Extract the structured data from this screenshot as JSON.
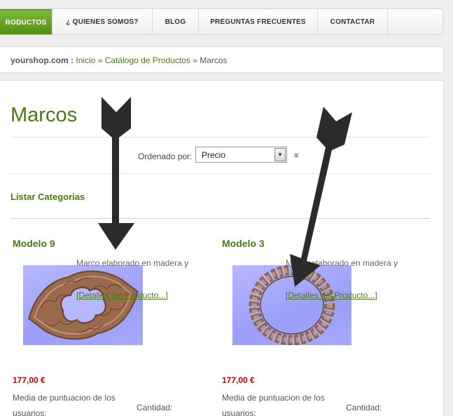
{
  "nav": {
    "items": [
      {
        "label": "RODUCTOS",
        "active": true
      },
      {
        "label": "¿ QUIENES SOMOS?"
      },
      {
        "label": "BLOG"
      },
      {
        "label": "PREGUNTAS FRECUENTES"
      },
      {
        "label": "CONTACTAR"
      }
    ]
  },
  "breadcrumb": {
    "host": "yourshop.com :",
    "home": "Inicio",
    "sep": "»",
    "catalog": "Catálogo de Productos",
    "current": "Marcos"
  },
  "page": {
    "title": "Marcos",
    "sort_label": "Ordenado por:",
    "sort_value": "Precio",
    "list_categories": "Listar Categorias"
  },
  "products": [
    {
      "name": "Modelo 9",
      "desc": "Marco elaborado en madera y",
      "link": "[Detalles del Producto...]",
      "price": "177,00 €",
      "rating": "Media de puntuacion de los usuarios:",
      "qty": "Cantidad:"
    },
    {
      "name": "Modelo 3",
      "desc": "Marco elaborado en madera y",
      "link": "[Detalles del Producto...]",
      "price": "177,00 €",
      "rating": "Media de puntuacion de los usuarios:",
      "qty": "Cantidad:"
    }
  ],
  "colors": {
    "accent": "#4a7a12",
    "price": "#c2000b",
    "nav_active": "#5fa01f",
    "arrow": "#2b2b2b"
  }
}
